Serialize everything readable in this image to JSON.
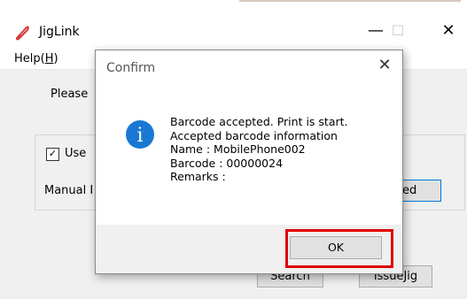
{
  "window": {
    "title": "JigLink",
    "minimize_glyph": "—",
    "maximize_glyph": "☐",
    "close_glyph": "✕"
  },
  "menu": {
    "help_prefix": "Help(",
    "help_accel": "H",
    "help_suffix": ")"
  },
  "main": {
    "prompt_label": "Please",
    "use_checkbox_label": "Use",
    "use_checked": true,
    "manual_label": "Manual I",
    "partial_button_label": "ed",
    "search_button_label": "Search",
    "issue_jig_button_label": "IssueJig"
  },
  "dialog": {
    "title": "Confirm",
    "icon": "info-icon",
    "icon_glyph": "i",
    "lines": [
      "Barcode accepted. Print is start.",
      "Accepted barcode information",
      "Name : MobilePhone002",
      "Barcode : 00000024",
      "Remarks :"
    ],
    "ok_label": "OK"
  },
  "colors": {
    "accent": "#1a78d4",
    "highlight": "#e00000",
    "app_icon": "#d43a3a"
  }
}
